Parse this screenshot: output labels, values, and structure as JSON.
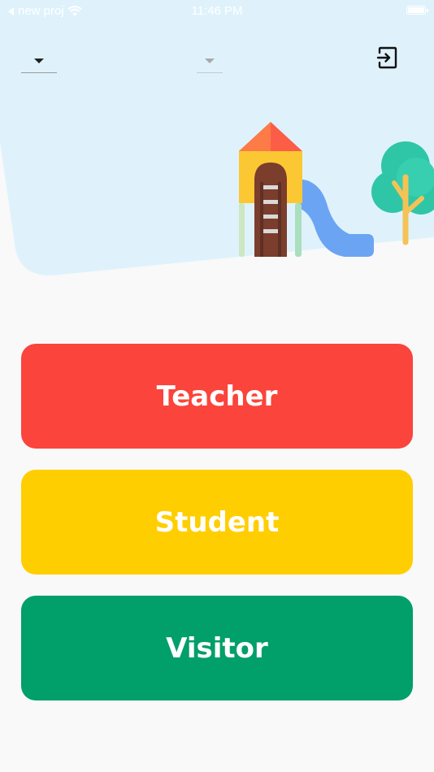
{
  "status_bar": {
    "back_label": "new proj",
    "time": "11:46 PM",
    "icons": [
      "back-arrow-icon",
      "wifi-icon",
      "battery-icon"
    ]
  },
  "header": {
    "background_color": "#dff2fc",
    "dropdown_primary": {
      "value": "",
      "caret_color": "#222222"
    },
    "dropdown_secondary": {
      "value": "",
      "caret_color": "#a9a9a9"
    },
    "logout_icon": "logout-icon"
  },
  "illustration": {
    "items": [
      "playground-slide-icon",
      "tree-icon"
    ]
  },
  "roles": {
    "teacher": {
      "label": "Teacher",
      "color": "#fb443c"
    },
    "student": {
      "label": "Student",
      "color": "#ffce00"
    },
    "visitor": {
      "label": "Visitor",
      "color": "#019f69"
    }
  }
}
